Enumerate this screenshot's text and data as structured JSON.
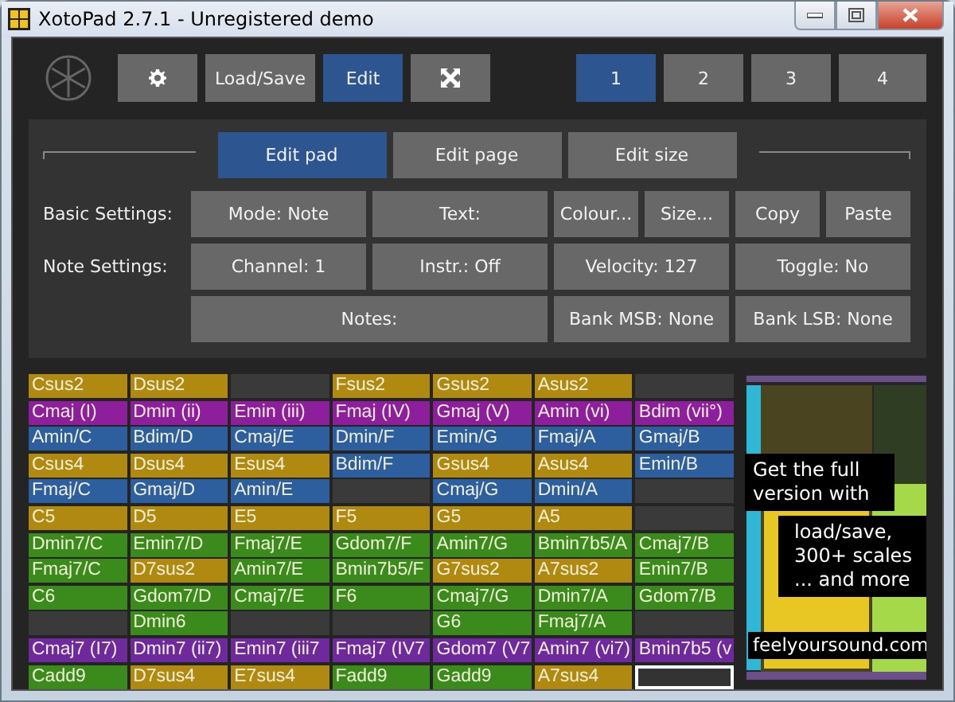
{
  "window": {
    "title": "XotoPad 2.7.1 - Unregistered demo"
  },
  "toolbar": [
    {
      "kind": "gear",
      "selected": false
    },
    {
      "kind": "text",
      "label": "Load/Save",
      "selected": false
    },
    {
      "kind": "text",
      "label": "Edit",
      "selected": true
    },
    {
      "kind": "expand",
      "selected": false
    }
  ],
  "pages": [
    {
      "label": "1",
      "selected": true
    },
    {
      "label": "2",
      "selected": false
    },
    {
      "label": "3",
      "selected": false
    },
    {
      "label": "4",
      "selected": false
    }
  ],
  "edit_tabs": [
    {
      "label": "Edit pad",
      "selected": true
    },
    {
      "label": "Edit page",
      "selected": false
    },
    {
      "label": "Edit size",
      "selected": false
    }
  ],
  "settings": [
    {
      "label": "Basic Settings:",
      "buttons": [
        "Mode: Note",
        "Text:",
        "Colour...",
        "Size...",
        "Copy",
        "Paste"
      ]
    },
    {
      "label": "Note Settings:",
      "buttons": [
        "Channel: 1",
        "Instr.: Off",
        "Velocity: 127",
        "Toggle: No"
      ]
    },
    {
      "buttons": [
        "Notes:",
        "Bank MSB: None",
        "Bank LSB: None"
      ]
    }
  ],
  "pads": [
    [
      {
        "label": "Csus2",
        "color": "#b08a10",
        "selected": false
      },
      {
        "label": "Dsus2",
        "color": "#b08a10",
        "selected": false
      },
      {
        "selected": false
      },
      {
        "label": "Fsus2",
        "color": "#b08a10",
        "selected": false
      },
      {
        "label": "Gsus2",
        "color": "#b08a10",
        "selected": false
      },
      {
        "label": "Asus2",
        "color": "#b08a10",
        "selected": false
      },
      {
        "selected": false
      }
    ],
    [
      {
        "label": "Cmaj (I)",
        "color": "#8e1f9c",
        "selected": false
      },
      {
        "label": "Dmin (ii)",
        "color": "#8e1f9c",
        "selected": false
      },
      {
        "label": "Emin (iii)",
        "color": "#8e1f9c",
        "selected": false
      },
      {
        "label": "Fmaj (IV)",
        "color": "#8e1f9c",
        "selected": false
      },
      {
        "label": "Gmaj (V)",
        "color": "#8e1f9c",
        "selected": false
      },
      {
        "label": "Amin (vi)",
        "color": "#8e1f9c",
        "selected": false
      },
      {
        "label": "Bdim (vii°)",
        "color": "#8e1f9c",
        "selected": false
      }
    ],
    [
      {
        "label": "Amin/C",
        "color": "#2d5e9e",
        "selected": false
      },
      {
        "label": "Bdim/D",
        "color": "#2d5e9e",
        "selected": false
      },
      {
        "label": "Cmaj/E",
        "color": "#2d5e9e",
        "selected": false
      },
      {
        "label": "Dmin/F",
        "color": "#2d5e9e",
        "selected": false
      },
      {
        "label": "Emin/G",
        "color": "#2d5e9e",
        "selected": false
      },
      {
        "label": "Fmaj/A",
        "color": "#2d5e9e",
        "selected": false
      },
      {
        "label": "Gmaj/B",
        "color": "#2d5e9e",
        "selected": false
      }
    ],
    [
      {
        "label": "Csus4",
        "color": "#b08a10",
        "selected": false
      },
      {
        "label": "Dsus4",
        "color": "#b08a10",
        "selected": false
      },
      {
        "label": "Esus4",
        "color": "#b08a10",
        "selected": false
      },
      {
        "label": "Bdim/F",
        "color": "#2d5e9e",
        "selected": false
      },
      {
        "label": "Gsus4",
        "color": "#b08a10",
        "selected": false
      },
      {
        "label": "Asus4",
        "color": "#b08a10",
        "selected": false
      },
      {
        "label": "Emin/B",
        "color": "#2d5e9e",
        "selected": false
      }
    ],
    [
      {
        "label": "Fmaj/C",
        "color": "#2d5e9e",
        "selected": false
      },
      {
        "label": "Gmaj/D",
        "color": "#2d5e9e",
        "selected": false
      },
      {
        "label": "Amin/E",
        "color": "#2d5e9e",
        "selected": false
      },
      {
        "selected": false
      },
      {
        "label": "Cmaj/G",
        "color": "#2d5e9e",
        "selected": false
      },
      {
        "label": "Dmin/A",
        "color": "#2d5e9e",
        "selected": false
      },
      {
        "selected": false
      }
    ],
    [
      {
        "label": "C5",
        "color": "#b08a10",
        "selected": false
      },
      {
        "label": "D5",
        "color": "#b08a10",
        "selected": false
      },
      {
        "label": "E5",
        "color": "#b08a10",
        "selected": false
      },
      {
        "label": "F5",
        "color": "#b08a10",
        "selected": false
      },
      {
        "label": "G5",
        "color": "#b08a10",
        "selected": false
      },
      {
        "label": "A5",
        "color": "#b08a10",
        "selected": false
      },
      {
        "selected": false
      }
    ],
    [
      {
        "label": "Dmin7/C",
        "color": "#3a8a1c",
        "selected": false
      },
      {
        "label": "Emin7/D",
        "color": "#3a8a1c",
        "selected": false
      },
      {
        "label": "Fmaj7/E",
        "color": "#3a8a1c",
        "selected": false
      },
      {
        "label": "Gdom7/F",
        "color": "#3a8a1c",
        "selected": false
      },
      {
        "label": "Amin7/G",
        "color": "#3a8a1c",
        "selected": false
      },
      {
        "label": "Bmin7b5/A",
        "color": "#3a8a1c",
        "selected": false
      },
      {
        "label": "Cmaj7/B",
        "color": "#3a8a1c",
        "selected": false
      }
    ],
    [
      {
        "label": "Fmaj7/C",
        "color": "#3a8a1c",
        "selected": false
      },
      {
        "label": "D7sus2",
        "color": "#b08a10",
        "selected": false
      },
      {
        "label": "Amin7/E",
        "color": "#3a8a1c",
        "selected": false
      },
      {
        "label": "Bmin7b5/F",
        "color": "#3a8a1c",
        "selected": false
      },
      {
        "label": "G7sus2",
        "color": "#b08a10",
        "selected": false
      },
      {
        "label": "A7sus2",
        "color": "#b08a10",
        "selected": false
      },
      {
        "label": "Emin7/B",
        "color": "#3a8a1c",
        "selected": false
      }
    ],
    [
      {
        "label": "C6",
        "color": "#3a8a1c",
        "selected": false
      },
      {
        "label": "Gdom7/D",
        "color": "#3a8a1c",
        "selected": false
      },
      {
        "label": "Cmaj7/E",
        "color": "#3a8a1c",
        "selected": false
      },
      {
        "label": "F6",
        "color": "#3a8a1c",
        "selected": false
      },
      {
        "label": "Cmaj7/G",
        "color": "#3a8a1c",
        "selected": false
      },
      {
        "label": "Dmin7/A",
        "color": "#3a8a1c",
        "selected": false
      },
      {
        "label": "Gdom7/B",
        "color": "#3a8a1c",
        "selected": false
      }
    ],
    [
      {
        "selected": false
      },
      {
        "label": "Dmin6",
        "color": "#3a8a1c",
        "selected": false
      },
      {
        "selected": false
      },
      {
        "selected": false
      },
      {
        "label": "G6",
        "color": "#3a8a1c",
        "selected": false
      },
      {
        "label": "Fmaj7/A",
        "color": "#3a8a1c",
        "selected": false
      },
      {
        "selected": false
      }
    ],
    [
      {
        "label": "Cmaj7 (I7)",
        "color": "#6e2a9c",
        "selected": false
      },
      {
        "label": "Dmin7 (ii7)",
        "color": "#6e2a9c",
        "selected": false
      },
      {
        "label": "Emin7 (iii7",
        "color": "#6e2a9c",
        "selected": false
      },
      {
        "label": "Fmaj7 (IV7",
        "color": "#6e2a9c",
        "selected": false
      },
      {
        "label": "Gdom7 (V7",
        "color": "#6e2a9c",
        "selected": false
      },
      {
        "label": "Amin7 (vi7)",
        "color": "#6e2a9c",
        "selected": false
      },
      {
        "label": "Bmin7b5 (v",
        "color": "#6e2a9c",
        "selected": false
      }
    ],
    [
      {
        "label": "Cadd9",
        "color": "#3a8a1c",
        "selected": false
      },
      {
        "label": "D7sus4",
        "color": "#b08a10",
        "selected": false
      },
      {
        "label": "E7sus4",
        "color": "#b08a10",
        "selected": false
      },
      {
        "label": "Fadd9",
        "color": "#3a8a1c",
        "selected": false
      },
      {
        "label": "Gadd9",
        "color": "#3a8a1c",
        "selected": false
      },
      {
        "label": "A7sus4",
        "color": "#b08a10",
        "selected": false
      },
      {
        "selected": true
      }
    ]
  ],
  "ad": {
    "kind": "picture",
    "headline": "Get the full version with",
    "features": "load/save, 300+ scales ... and more",
    "url": "feelyoursound.com"
  }
}
